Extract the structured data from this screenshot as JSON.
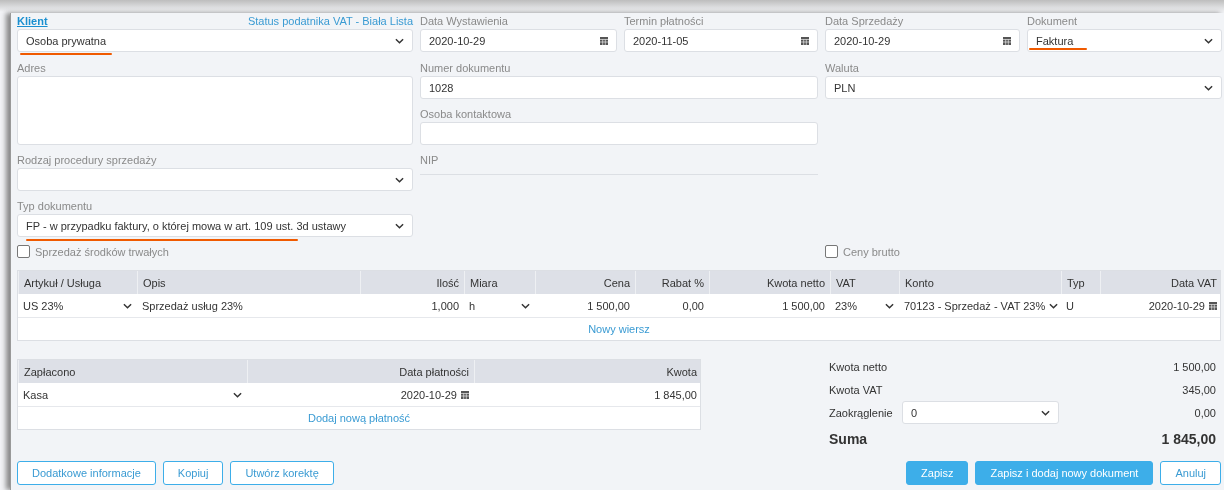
{
  "client": {
    "label": "Klient",
    "status_link": "Status podatnika VAT - Biała Lista",
    "value": "Osoba prywatna",
    "annotated": true
  },
  "date_fields": [
    {
      "label": "Data Wystawienia",
      "value": "2020-10-29"
    },
    {
      "label": "Termin płatności",
      "value": "2020-11-05"
    },
    {
      "label": "Data Sprzedaży",
      "value": "2020-10-29"
    }
  ],
  "document": {
    "label": "Dokument",
    "value": "Faktura",
    "annotated": true
  },
  "address": {
    "label": "Adres"
  },
  "document_number": {
    "label": "Numer dokumentu",
    "value": "1028"
  },
  "contact_person": {
    "label": "Osoba kontaktowa"
  },
  "nip": {
    "label": "NIP"
  },
  "currency": {
    "label": "Waluta",
    "value": "PLN"
  },
  "sale_procedure": {
    "label": "Rodzaj procedury sprzedaży"
  },
  "document_type": {
    "label": "Typ dokumentu",
    "value": "FP - w przypadku faktury, o której mowa w art. 109 ust. 3d ustawy",
    "annotated": true
  },
  "checkboxes": [
    {
      "label": "Sprzedaż środków trwałych",
      "checked": false
    },
    {
      "label": "Ceny brutto",
      "checked": false
    }
  ],
  "items_table": {
    "columns": [
      "Artykuł / Usługa",
      "Opis",
      "Ilość",
      "Miara",
      "Cena",
      "Rabat %",
      "Kwota netto",
      "VAT",
      "Konto",
      "Typ",
      "Data VAT"
    ],
    "rows": [
      {
        "cells": [
          {
            "kind": "select",
            "text": "US 23%"
          },
          {
            "kind": "text",
            "text": "Sprzedaż usług 23%"
          },
          {
            "kind": "text",
            "text": "1,000"
          },
          {
            "kind": "select",
            "text": "h"
          },
          {
            "kind": "text",
            "text": "1 500,00"
          },
          {
            "kind": "text",
            "text": "0,00"
          },
          {
            "kind": "text",
            "text": "1 500,00"
          },
          {
            "kind": "select",
            "text": "23%"
          },
          {
            "kind": "select",
            "text": "70123 - Sprzedaż - VAT 23%"
          },
          {
            "kind": "text",
            "text": "U"
          },
          {
            "kind": "date",
            "text": "2020-10-29"
          }
        ]
      }
    ],
    "add_row": "Nowy wiersz"
  },
  "payments_table": {
    "columns": [
      "Zapłacono",
      "Data płatności",
      "Kwota"
    ],
    "rows": [
      {
        "cells": [
          {
            "kind": "select",
            "text": "Kasa"
          },
          {
            "kind": "date",
            "text": "2020-10-29"
          },
          {
            "kind": "text",
            "text": "1 845,00"
          }
        ]
      }
    ],
    "add_row": "Dodaj nową płatność"
  },
  "summary": [
    {
      "kind": "text",
      "label": "Kwota netto",
      "value": "1 500,00"
    },
    {
      "kind": "text",
      "label": "Kwota VAT",
      "value": "345,00"
    },
    {
      "kind": "select",
      "label": "Zaokrąglenie",
      "option": "0",
      "value": "0,00"
    },
    {
      "kind": "total",
      "label": "Suma",
      "value": "1 845,00"
    }
  ],
  "left_buttons": [
    {
      "label": "Dodatkowe informacje",
      "kind": "outline"
    },
    {
      "label": "Kopiuj",
      "kind": "outline"
    },
    {
      "label": "Utwórz korektę",
      "kind": "outline"
    }
  ],
  "right_buttons": [
    {
      "label": "Zapisz",
      "kind": "primary"
    },
    {
      "label": "Zapisz i dodaj nowy dokument",
      "kind": "primary"
    },
    {
      "label": "Anuluj",
      "kind": "outline"
    }
  ]
}
